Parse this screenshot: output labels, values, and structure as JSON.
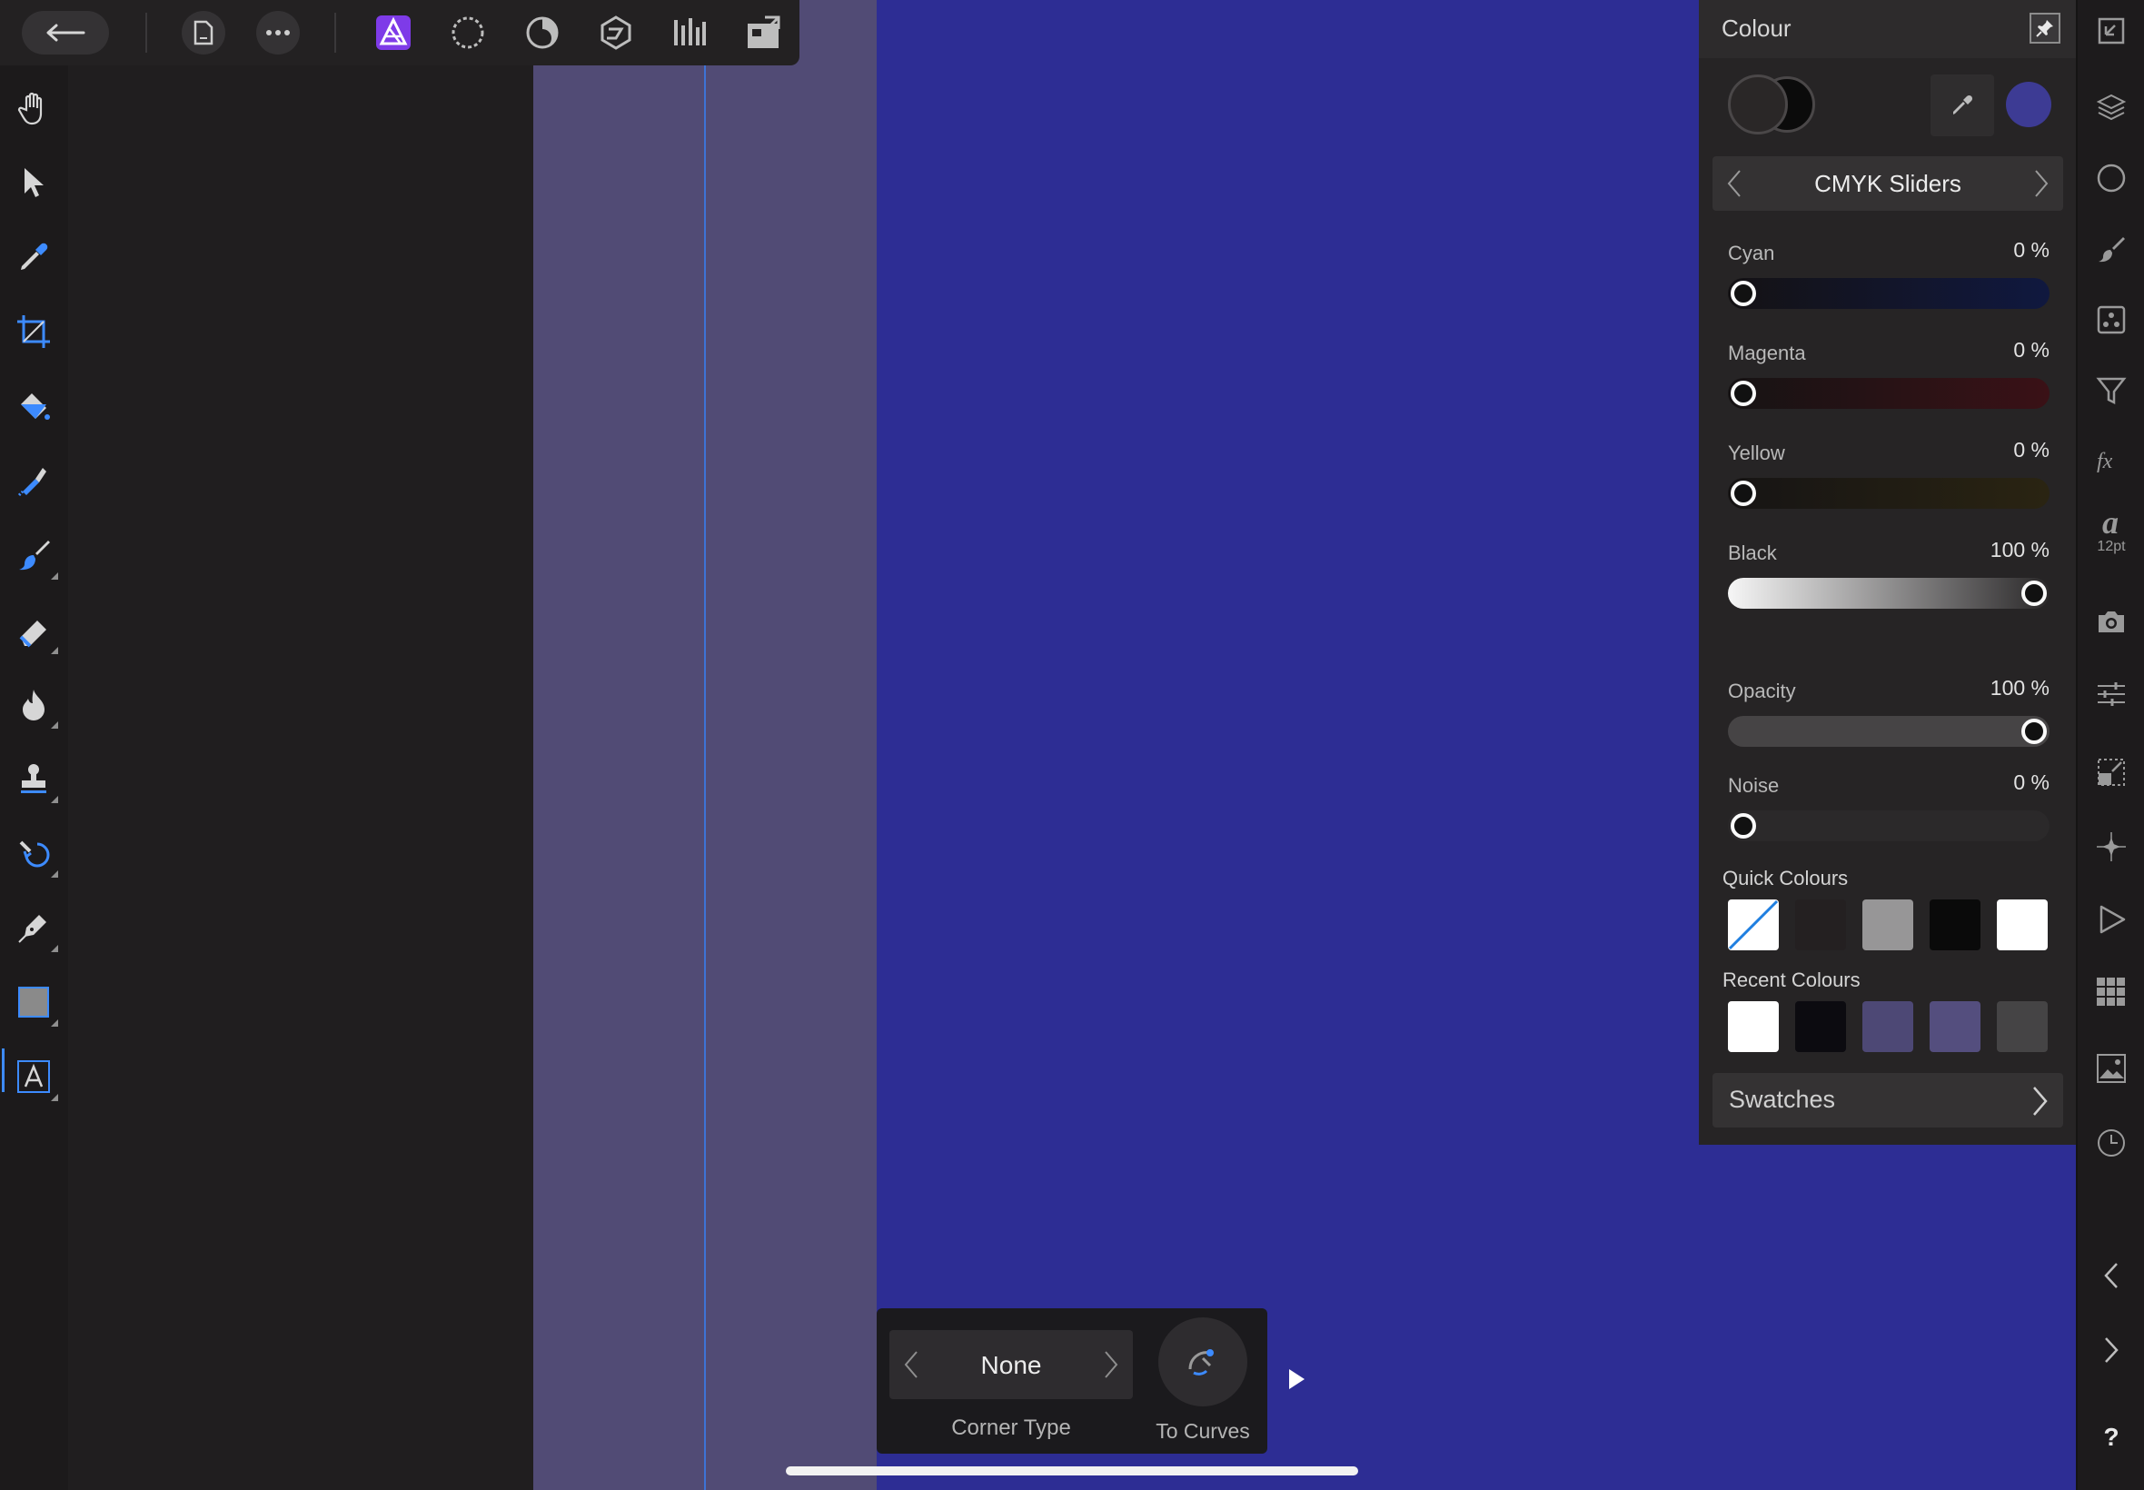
{
  "colors": {
    "accent": "#3d8bff",
    "artboard_fill": "#2d2d94",
    "artboard_edge": "#514b75",
    "guide": "#3d73d6",
    "panel_bg": "#262425",
    "recent_colour_accent": "#4d4875"
  },
  "top_toolbar": {
    "back_icon": "arrow-left-icon",
    "document_icon": "document-icon",
    "more_icon": "ellipsis-icon",
    "personas": [
      "photo-persona-icon",
      "liquify-persona-icon",
      "develop-persona-icon",
      "tone-mapping-persona-icon",
      "export-persona-icon"
    ],
    "extra_icon": "macro-icon"
  },
  "left_tools": [
    "view-hand-icon",
    "move-pointer-icon",
    "colour-picker-icon",
    "crop-icon",
    "flood-fill-icon",
    "selection-brush-icon",
    "paint-brush-icon",
    "erase-brush-icon",
    "dodge-burn-icon",
    "clone-stamp-icon",
    "retouch-icon",
    "pen-icon",
    "rectangle-shape-icon",
    "artistic-text-icon"
  ],
  "colour_panel": {
    "title": "Colour",
    "model": "CMYK Sliders",
    "sliders": [
      {
        "label": "Cyan",
        "value": "0 %",
        "level": 0
      },
      {
        "label": "Magenta",
        "value": "0 %",
        "level": 0
      },
      {
        "label": "Yellow",
        "value": "0 %",
        "level": 0
      },
      {
        "label": "Black",
        "value": "100 %",
        "level": 1
      }
    ],
    "opacity": {
      "label": "Opacity",
      "value": "100 %",
      "level": 1
    },
    "noise": {
      "label": "Noise",
      "value": "0 %",
      "level": 0
    },
    "quick_colours_title": "Quick Colours",
    "quick_colours": [
      "none",
      "#242021",
      "#979697",
      "#0a0a0a",
      "#ffffff"
    ],
    "recent_colours_title": "Recent Colours",
    "recent_colours": [
      "#ffffff",
      "#0c0b10",
      "#4d4875",
      "#544e7e",
      "#454445"
    ],
    "swatches_label": "Swatches"
  },
  "studio_icons": [
    "navigator-icon",
    "layers-icon",
    "channels-icon",
    "brushes-icon",
    "dither-icon",
    "filter-icon",
    "effects-icon",
    "text-style-icon",
    "camera-icon",
    "adjustments-icon",
    "transform-icon",
    "snapping-icon",
    "macro-play-icon",
    "stock-grid-icon",
    "stock-image-icon",
    "history-icon"
  ],
  "studio_text_icon_size": "12pt",
  "context_toolbar": {
    "corner_value": "None",
    "corner_label": "Corner Type",
    "to_curves_label": "To Curves"
  },
  "bottom_right_controls": [
    "collapse-left-icon",
    "collapse-right-icon",
    "help-icon"
  ],
  "help_glyph": "?"
}
